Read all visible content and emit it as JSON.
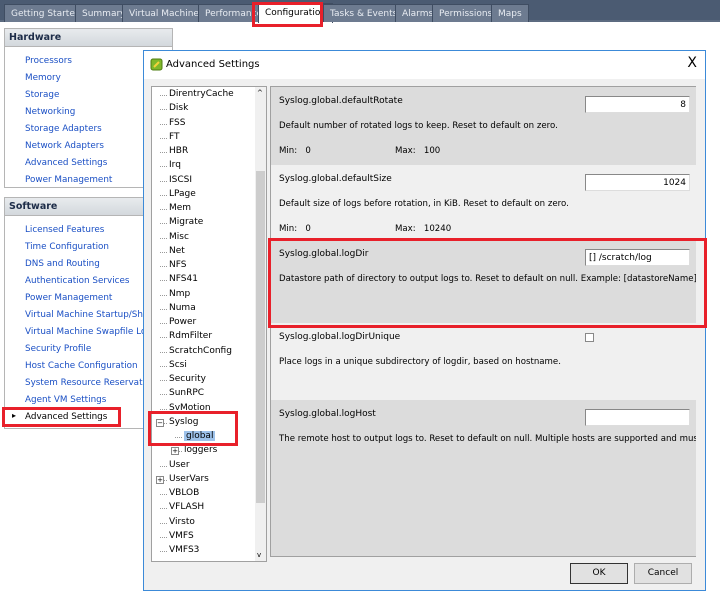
{
  "tabs": [
    "Getting Started",
    "Summary",
    "Virtual Machines",
    "Performance",
    "Configuration",
    "Tasks & Events",
    "Alarms",
    "Permissions",
    "Maps"
  ],
  "active_tab": "Configuration",
  "hardware": {
    "title": "Hardware",
    "items": [
      "Processors",
      "Memory",
      "Storage",
      "Networking",
      "Storage Adapters",
      "Network Adapters",
      "Advanced Settings",
      "Power Management"
    ]
  },
  "software": {
    "title": "Software",
    "items": [
      "Licensed Features",
      "Time Configuration",
      "DNS and Routing",
      "Authentication Services",
      "Power Management",
      "Virtual Machine Startup/Shutdown",
      "Virtual Machine Swapfile Location",
      "Security Profile",
      "Host Cache Configuration",
      "System Resource Reservation",
      "Agent VM Settings",
      "Advanced Settings"
    ],
    "selected": "Advanced Settings"
  },
  "dialog": {
    "title": "Advanced Settings",
    "close": "X",
    "ok": "OK",
    "cancel": "Cancel"
  },
  "tree": [
    "DirentryCache",
    "Disk",
    "FSS",
    "FT",
    "HBR",
    "Irq",
    "ISCSI",
    "LPage",
    "Mem",
    "Migrate",
    "Misc",
    "Net",
    "NFS",
    "NFS41",
    "Nmp",
    "Numa",
    "Power",
    "RdmFilter",
    "ScratchConfig",
    "Scsi",
    "Security",
    "SunRPC",
    "SvMotion",
    "Syslog",
    "global",
    "loggers",
    "User",
    "UserVars",
    "VBLOB",
    "VFLASH",
    "Virsto",
    "VMFS",
    "VMFS3"
  ],
  "tree_selected": "global",
  "settings": [
    {
      "name": "Syslog.global.defaultRotate",
      "value": "8",
      "desc": "Default number of rotated logs to keep. Reset to default on zero.",
      "min": "Min:   0",
      "max": "Max:   100"
    },
    {
      "name": "Syslog.global.defaultSize",
      "value": "1024",
      "desc": "Default size of logs before rotation, in KiB. Reset to default on zero.",
      "min": "Min:   0",
      "max": "Max:   10240"
    },
    {
      "name": "Syslog.global.logDir",
      "value": "[] /scratch/log",
      "desc": "Datastore path of directory to output logs to. Reset to default on null. Example: [datastoreName]/logdir"
    },
    {
      "name": "Syslog.global.logDirUnique",
      "checked": false,
      "desc": "Place logs in a unique subdirectory of logdir, based on hostname."
    },
    {
      "name": "Syslog.global.logHost",
      "value": "",
      "desc": "The remote host to output logs to. Reset to default on null. Multiple hosts are supported and must be s.."
    }
  ],
  "colors": {
    "highlight": "#e8202a",
    "link": "#1a4fc4",
    "tabbar": "#4b5b72"
  }
}
